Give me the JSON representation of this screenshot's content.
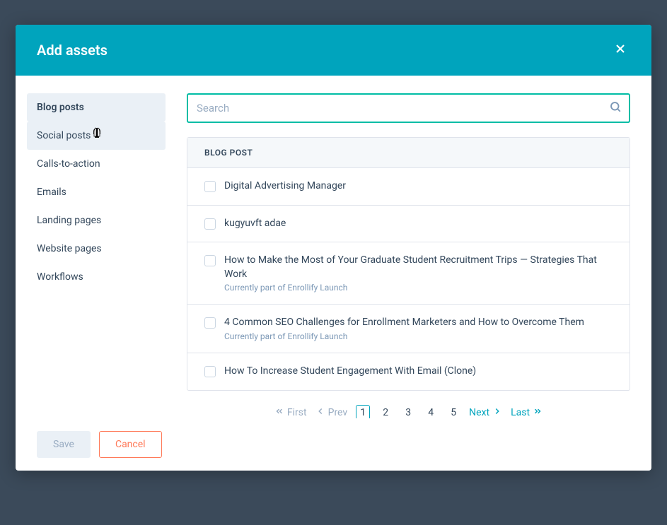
{
  "modal": {
    "title": "Add assets"
  },
  "sidebar": {
    "items": [
      {
        "label": "Blog posts",
        "active": true
      },
      {
        "label": "Social posts",
        "hover": true
      },
      {
        "label": "Calls-to-action"
      },
      {
        "label": "Emails"
      },
      {
        "label": "Landing pages"
      },
      {
        "label": "Website pages"
      },
      {
        "label": "Workflows"
      }
    ]
  },
  "search": {
    "placeholder": "Search",
    "value": ""
  },
  "table": {
    "header": "BLOG POST",
    "rows": [
      {
        "title": "Digital Advertising Manager"
      },
      {
        "title": "kugyuvft adae"
      },
      {
        "title": "How to Make the Most of Your Graduate Student Recruitment Trips — Strategies That Work",
        "subtitle": "Currently part of Enrollify Launch"
      },
      {
        "title": "4 Common SEO Challenges for Enrollment Marketers and How to Overcome Them",
        "subtitle": "Currently part of Enrollify Launch"
      },
      {
        "title": "How To Increase Student Engagement With Email (Clone)"
      }
    ]
  },
  "pagination": {
    "first": "First",
    "prev": "Prev",
    "pages": [
      "1",
      "2",
      "3",
      "4",
      "5"
    ],
    "current": "1",
    "next": "Next",
    "last": "Last"
  },
  "footer": {
    "save": "Save",
    "cancel": "Cancel"
  }
}
